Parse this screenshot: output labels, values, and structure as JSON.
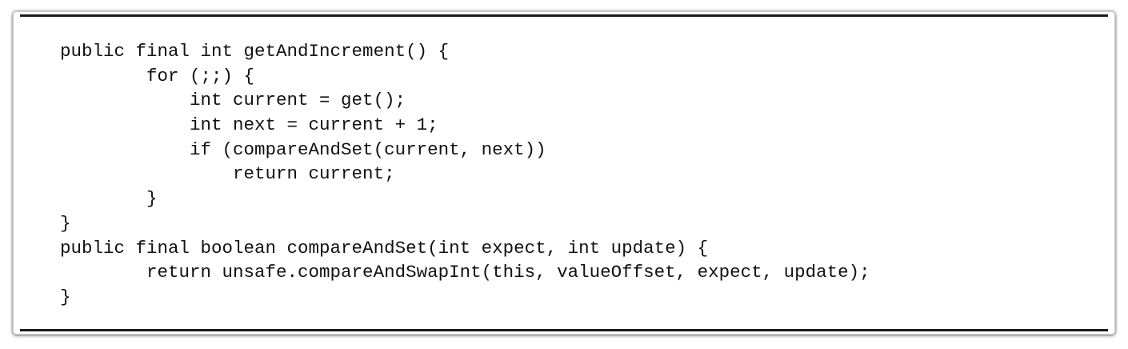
{
  "code": {
    "lines": [
      "public final int getAndIncrement() {",
      "        for (;;) {",
      "            int current = get();",
      "            int next = current + 1;",
      "            if (compareAndSet(current, next))",
      "                return current;",
      "        }",
      "}",
      "public final boolean compareAndSet(int expect, int update) {",
      "        return unsafe.compareAndSwapInt(this, valueOffset, expect, update);",
      "}"
    ]
  }
}
